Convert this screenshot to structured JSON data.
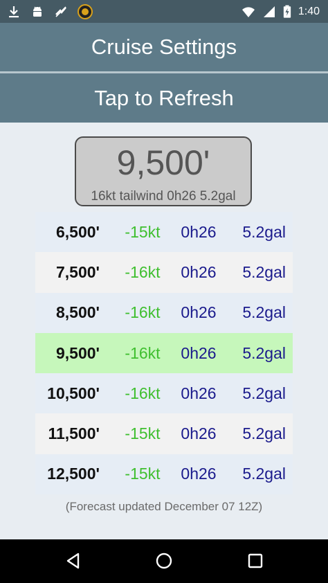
{
  "status_bar": {
    "time": "1:40",
    "left_icons": [
      "download-icon",
      "android-icon",
      "no-sync-icon",
      "app-badge-icon"
    ],
    "right_icons": [
      "wifi-icon",
      "signal-icon",
      "battery-icon"
    ]
  },
  "header": {
    "title": "Cruise Settings",
    "refresh_label": "Tap to Refresh"
  },
  "selected": {
    "altitude": "9,500'",
    "detail": "16kt tailwind 0h26 5.2gal"
  },
  "table": {
    "rows": [
      {
        "altitude": "6,500'",
        "wind": "-15kt",
        "time": "0h26",
        "fuel": "5.2gal"
      },
      {
        "altitude": "7,500'",
        "wind": "-16kt",
        "time": "0h26",
        "fuel": "5.2gal"
      },
      {
        "altitude": "8,500'",
        "wind": "-16kt",
        "time": "0h26",
        "fuel": "5.2gal"
      },
      {
        "altitude": "9,500'",
        "wind": "-16kt",
        "time": "0h26",
        "fuel": "5.2gal"
      },
      {
        "altitude": "10,500'",
        "wind": "-16kt",
        "time": "0h26",
        "fuel": "5.2gal"
      },
      {
        "altitude": "11,500'",
        "wind": "-15kt",
        "time": "0h26",
        "fuel": "5.2gal"
      },
      {
        "altitude": "12,500'",
        "wind": "-15kt",
        "time": "0h26",
        "fuel": "5.2gal"
      }
    ],
    "selected_index": 3
  },
  "footer": {
    "note": "(Forecast updated December 07 12Z)"
  },
  "nav_bar": {
    "icons": [
      "back-icon",
      "home-icon",
      "recents-icon"
    ]
  },
  "colors": {
    "header_bg": "#5e7b89",
    "status_bg": "#455a64",
    "wind_green": "#3fbf2f",
    "value_navy": "#1a1a8c",
    "selected_row": "#c6f7bb"
  }
}
